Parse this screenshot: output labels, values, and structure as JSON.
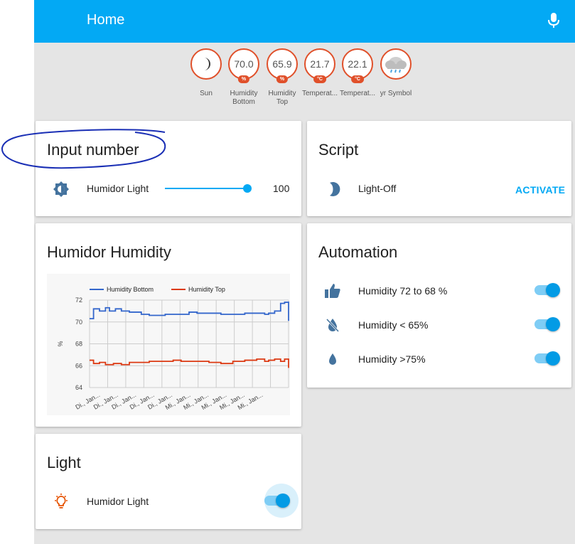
{
  "header": {
    "title": "Home"
  },
  "badges": [
    {
      "value": "",
      "unit": "",
      "label": "Sun",
      "icon": "moon-icon"
    },
    {
      "value": "70.0",
      "unit": "%",
      "label": "Humidity Bottom",
      "icon": ""
    },
    {
      "value": "65.9",
      "unit": "%",
      "label": "Humidity Top",
      "icon": ""
    },
    {
      "value": "21.7",
      "unit": "°C",
      "label": "Temperat...",
      "icon": ""
    },
    {
      "value": "22.1",
      "unit": "°C",
      "label": "Temperat...",
      "icon": ""
    },
    {
      "value": "",
      "unit": "",
      "label": "yr Symbol",
      "icon": "rain-cloud-icon"
    }
  ],
  "input_number": {
    "title": "Input number",
    "item_label": "Humidor Light",
    "value": "100",
    "slider_fraction": 1.0,
    "icon": "brightness-icon"
  },
  "script": {
    "title": "Script",
    "item_label": "Light-Off",
    "action_label": "ACTIVATE",
    "icon": "moon-icon"
  },
  "humidity_chart": {
    "title": "Humidor Humidity"
  },
  "automation": {
    "title": "Automation",
    "items": [
      {
        "label": "Humidity 72 to 68 %",
        "icon": "thumb-up-icon",
        "on": true
      },
      {
        "label": "Humidity < 65%",
        "icon": "water-off-icon",
        "on": true
      },
      {
        "label": "Humidity >75%",
        "icon": "water-drop-icon",
        "on": true
      }
    ]
  },
  "light": {
    "title": "Light",
    "item_label": "Humidor Light",
    "icon": "lightbulb-icon",
    "on": true
  },
  "chart_data": {
    "type": "line",
    "title": "",
    "xlabel": "",
    "ylabel": "%",
    "ylim": [
      64,
      72
    ],
    "yticks": [
      "72",
      "70",
      "68",
      "66",
      "64"
    ],
    "xtick_labels": [
      "Di., Jan...",
      "Di., Jan...",
      "Di., Jan...",
      "Di., Jan...",
      "Di., Jan...",
      "Mi., Jan...",
      "Mi., Jan...",
      "Mi., Jan...",
      "Mi., Jan...",
      "Mi., Jan..."
    ],
    "legend_position": "top",
    "grid": true,
    "series": [
      {
        "name": "Humidity Bottom",
        "color": "#3366cc",
        "step": true,
        "x": [
          0,
          0.02,
          0.05,
          0.08,
          0.1,
          0.13,
          0.16,
          0.2,
          0.26,
          0.3,
          0.38,
          0.46,
          0.5,
          0.54,
          0.6,
          0.66,
          0.72,
          0.78,
          0.84,
          0.88,
          0.9,
          0.93,
          0.96,
          0.98,
          0.995,
          1.0
        ],
        "y": [
          70.3,
          71.2,
          71.0,
          71.3,
          71.0,
          71.2,
          71.0,
          70.9,
          70.7,
          70.6,
          70.7,
          70.7,
          70.9,
          70.8,
          70.8,
          70.7,
          70.7,
          70.8,
          70.8,
          70.7,
          70.8,
          71.0,
          71.7,
          71.8,
          71.8,
          70.1
        ]
      },
      {
        "name": "Humidity Top",
        "color": "#dc3912",
        "step": true,
        "x": [
          0,
          0.02,
          0.05,
          0.08,
          0.12,
          0.16,
          0.2,
          0.26,
          0.3,
          0.36,
          0.42,
          0.46,
          0.54,
          0.6,
          0.66,
          0.72,
          0.78,
          0.84,
          0.88,
          0.9,
          0.93,
          0.96,
          0.98,
          0.995,
          1.0
        ],
        "y": [
          66.5,
          66.2,
          66.3,
          66.1,
          66.2,
          66.1,
          66.3,
          66.3,
          66.4,
          66.4,
          66.5,
          66.4,
          66.4,
          66.3,
          66.2,
          66.4,
          66.5,
          66.6,
          66.4,
          66.5,
          66.6,
          66.4,
          66.6,
          66.6,
          65.8
        ]
      }
    ]
  }
}
